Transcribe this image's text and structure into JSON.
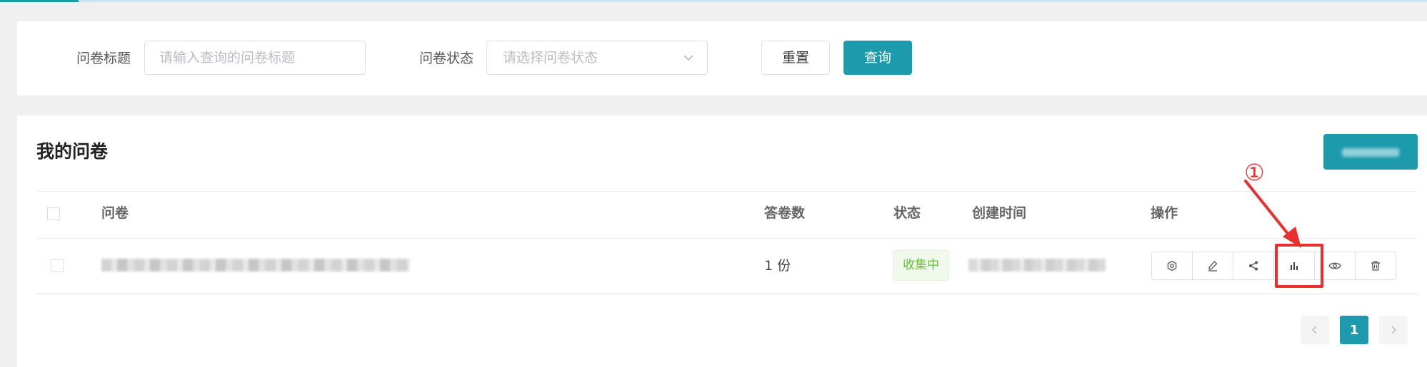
{
  "filters": {
    "title_label": "问卷标题",
    "title_placeholder": "请输入查询的问卷标题",
    "status_label": "问卷状态",
    "status_placeholder": "请选择问卷状态",
    "reset_label": "重置",
    "search_label": "查询"
  },
  "panel": {
    "title": "我的问卷"
  },
  "table": {
    "columns": {
      "survey": "问卷",
      "responses": "答卷数",
      "status": "状态",
      "created": "创建时间",
      "actions": "操作"
    },
    "rows": [
      {
        "responses": "1 份",
        "status": "收集中",
        "actions": [
          "settings-icon",
          "edit-icon",
          "share-icon",
          "statistics-icon",
          "preview-icon",
          "delete-icon"
        ]
      }
    ]
  },
  "annotation": {
    "number": "①"
  },
  "pagination": {
    "current_page": "1"
  },
  "colors": {
    "primary": "#1e9aad",
    "status_green": "#67c23a",
    "annotation_red": "#e8312f"
  }
}
